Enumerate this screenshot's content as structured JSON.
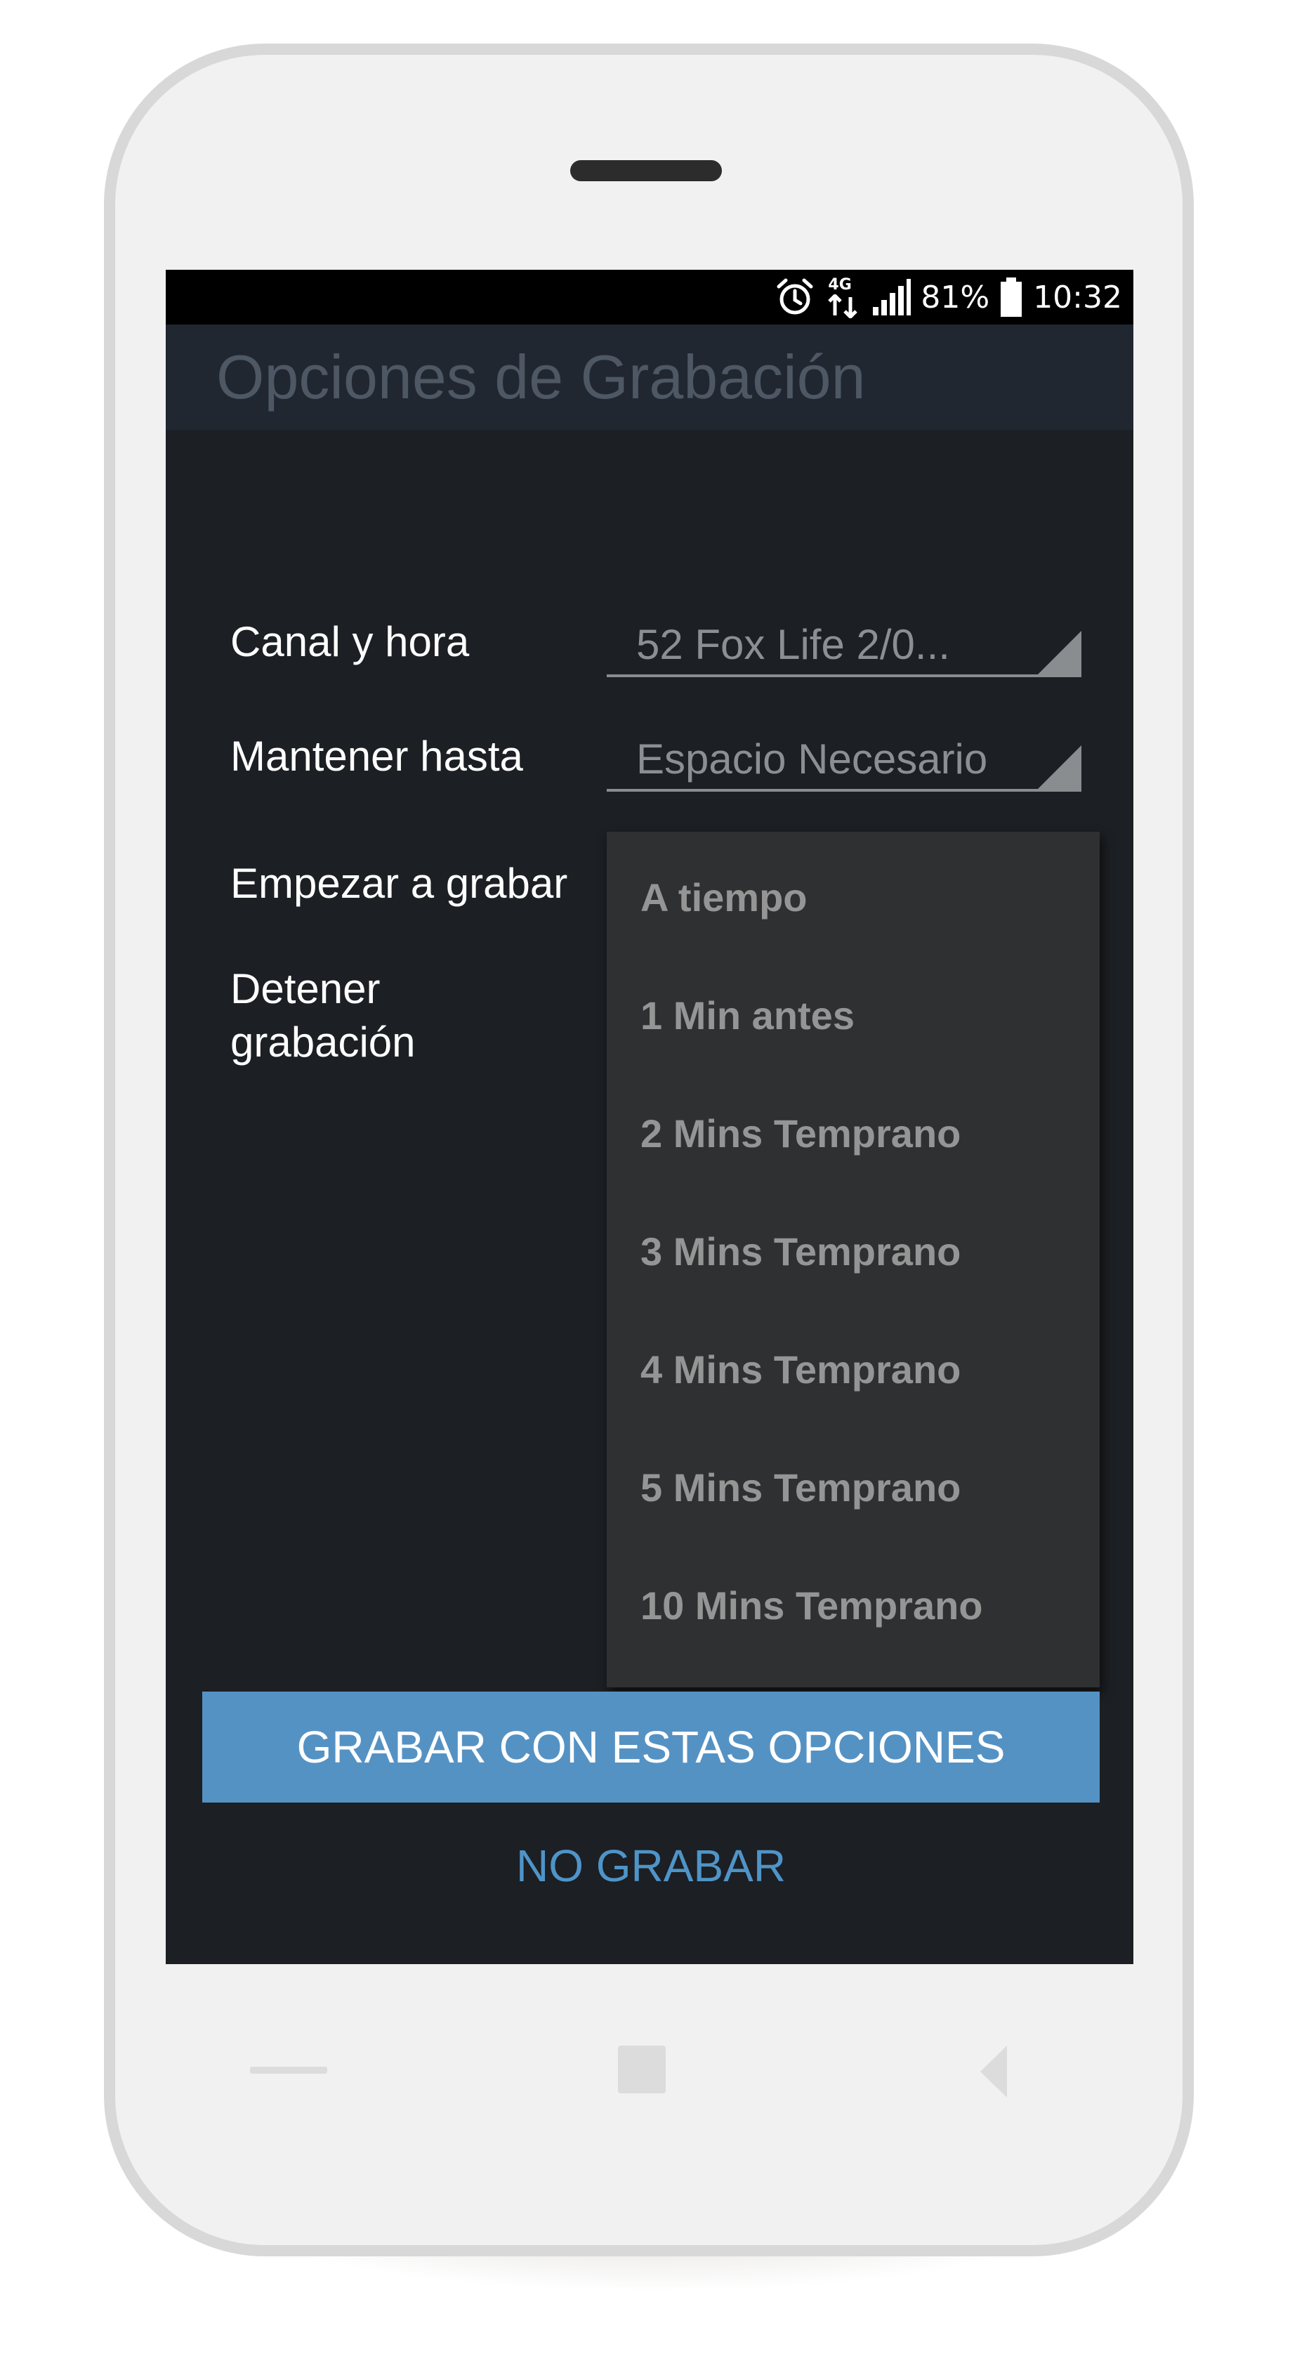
{
  "status_bar": {
    "network": "4G",
    "battery_percent": "81%",
    "time": "10:32",
    "icons": [
      "alarm-icon",
      "network-4g-icon",
      "signal-icon",
      "battery-icon"
    ]
  },
  "header": {
    "title": "Opciones de Grabación"
  },
  "form": {
    "channel_label": "Canal y hora",
    "channel_value": "52 Fox Life 2/0...",
    "keep_label": "Mantener hasta",
    "keep_value": "Espacio Necesario",
    "start_label": "Empezar a grabar",
    "stop_label": "Detener grabación"
  },
  "dropdown": {
    "options": [
      "A tiempo",
      "1 Min antes",
      "2 Mins Temprano",
      "3 Mins Temprano",
      "4 Mins Temprano",
      "5 Mins Temprano",
      "10 Mins Temprano"
    ]
  },
  "actions": {
    "record_label": "GRABAR CON ESTAS OPCIONES",
    "cancel_label": "NO GRABAR"
  },
  "colors": {
    "accent": "#5592c4",
    "screen_background": "#1c1f23",
    "header_background": "#202731",
    "dropdown_background": "#2f3031"
  }
}
